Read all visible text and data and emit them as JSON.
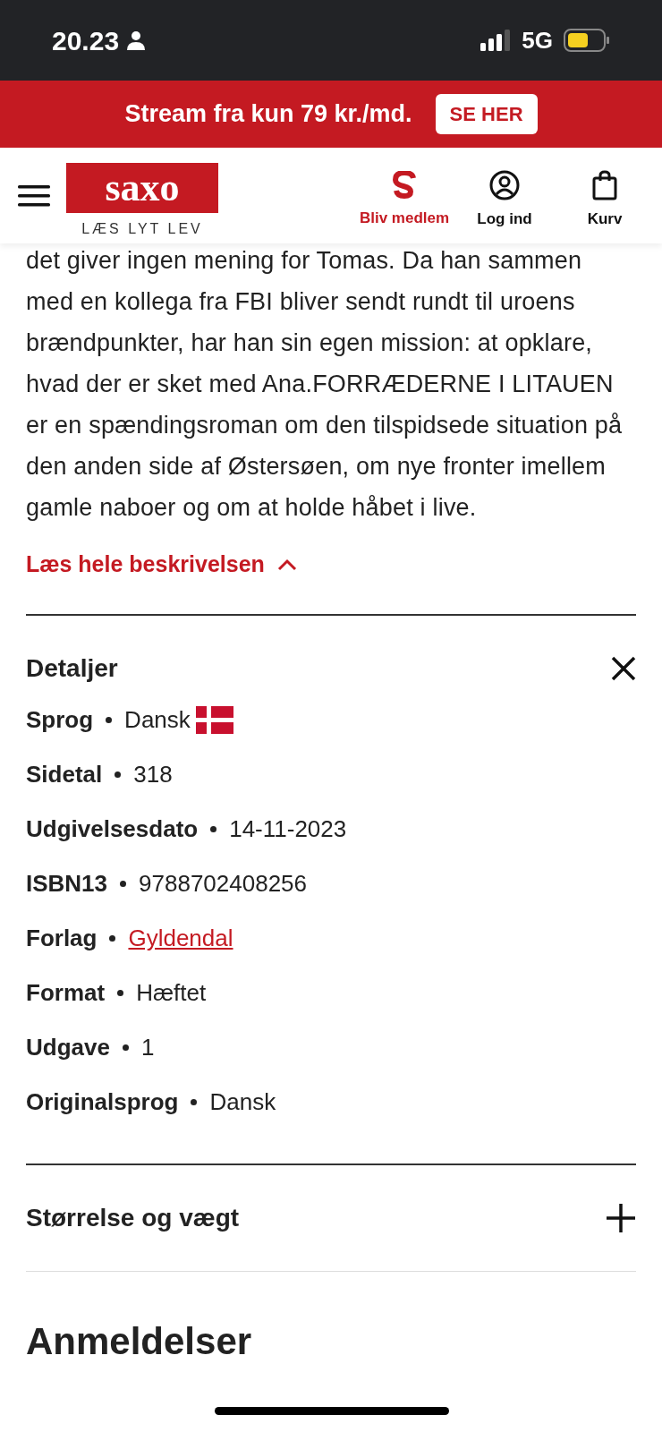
{
  "status_bar": {
    "time": "20.23",
    "network": "5G"
  },
  "promo_banner": {
    "text": "Stream fra kun 79 kr./md.",
    "button": "SE HER"
  },
  "header": {
    "logo": "saxo",
    "tagline": "LÆS LYT LEV",
    "actions": [
      {
        "kind": "member",
        "label": "Bliv medlem"
      },
      {
        "kind": "login",
        "label": "Log ind"
      },
      {
        "kind": "cart",
        "label": "Kurv"
      }
    ]
  },
  "description": {
    "text": "det giver ingen mening for Tomas. Da han sammen med en kollega fra FBI bliver sendt rundt til uroens brændpunkter, har han sin egen mission: at opklare, hvad der er sket med Ana.FORRÆDERNE I LITAUEN er en spændingsroman om den tilspidsede situation på den anden side af Østersøen, om nye fronter imellem gamle naboer og om at holde håbet i live.",
    "toggle": "Læs hele beskrivelsen",
    "expanded": true
  },
  "sections": [
    {
      "title": "Detaljer",
      "expanded": true,
      "rows": [
        {
          "kind": "language",
          "label": "Sprog",
          "value": "Dansk"
        },
        {
          "kind": "text",
          "label": "Sidetal",
          "value": "318"
        },
        {
          "kind": "text",
          "label": "Udgivelsesdato",
          "value": "14-11-2023"
        },
        {
          "kind": "text",
          "label": "ISBN13",
          "value": "9788702408256"
        },
        {
          "kind": "link",
          "label": "Forlag",
          "value": "Gyldendal"
        },
        {
          "kind": "text",
          "label": "Format",
          "value": "Hæftet"
        },
        {
          "kind": "text",
          "label": "Udgave",
          "value": "1"
        },
        {
          "kind": "text",
          "label": "Originalsprog",
          "value": "Dansk"
        }
      ]
    },
    {
      "title": "Størrelse og vægt",
      "expanded": false
    }
  ],
  "next_heading": "Anmeldelser"
}
